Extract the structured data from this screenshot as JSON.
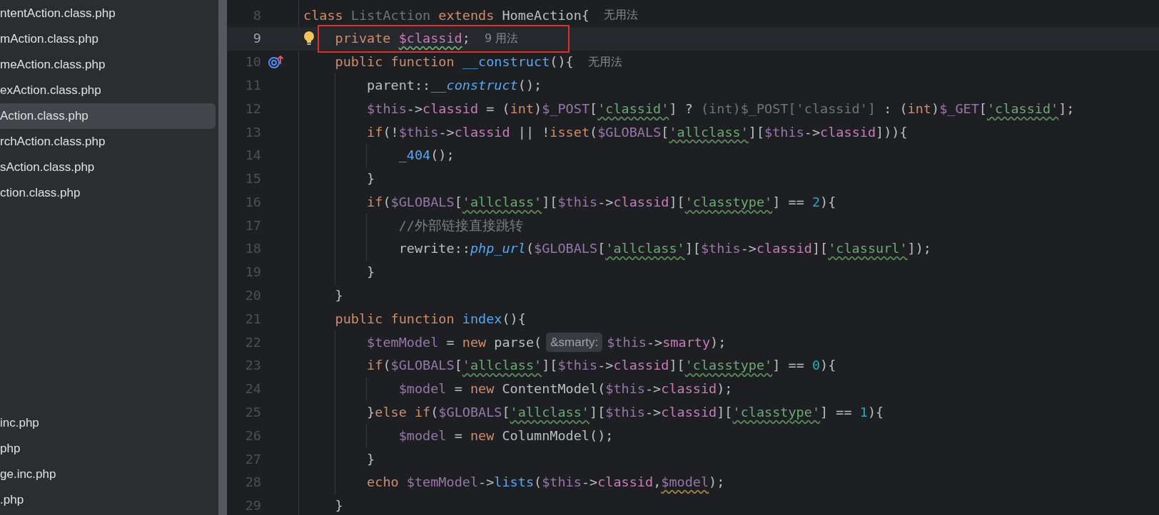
{
  "sidebar": {
    "groups": [
      [
        {
          "label": "ntentAction.class.php",
          "selected": false
        },
        {
          "label": "mAction.class.php",
          "selected": false
        },
        {
          "label": "meAction.class.php",
          "selected": false
        },
        {
          "label": "exAction.class.php",
          "selected": false
        },
        {
          "label": "Action.class.php",
          "selected": true
        },
        {
          "label": "rchAction.class.php",
          "selected": false
        },
        {
          "label": "sAction.class.php",
          "selected": false
        },
        {
          "label": "ction.class.php",
          "selected": false
        }
      ],
      [
        {
          "label": "inc.php",
          "selected": false
        },
        {
          "label": "php",
          "selected": false
        },
        {
          "label": "ge.inc.php",
          "selected": false
        },
        {
          "label": ".php",
          "selected": false
        }
      ]
    ]
  },
  "editor": {
    "lines": [
      {
        "number": "8",
        "current": false,
        "segments": [
          {
            "kind": "code",
            "tokens": [
              {
                "text": "class ",
                "kind": "kw"
              },
              {
                "text": "ListAction",
                "kind": "dim"
              },
              {
                "text": " extends ",
                "kind": "kw"
              },
              {
                "text": "HomeAction{",
                "kind": "p"
              }
            ]
          },
          {
            "kind": "usage_hint",
            "text": "无用法"
          }
        ],
        "children": [
          {
            "number": "9",
            "current": true,
            "framed": true,
            "bulb": true,
            "segments": [
              {
                "kind": "code",
                "tokens": [
                  {
                    "text": "private ",
                    "kind": "kw"
                  },
                  {
                    "text": "$classid",
                    "kind": "field_typo"
                  },
                  {
                    "text": ";",
                    "kind": "p"
                  }
                ]
              },
              {
                "kind": "usage_hint",
                "text": "9 用法"
              }
            ]
          },
          {
            "number": "10",
            "current": false,
            "override_mark": true,
            "segments": [
              {
                "kind": "code",
                "tokens": [
                  {
                    "text": "public function ",
                    "kind": "kw"
                  },
                  {
                    "text": "__construct",
                    "kind": "fn"
                  },
                  {
                    "text": "(){",
                    "kind": "p"
                  }
                ]
              },
              {
                "kind": "usage_hint",
                "text": "无用法"
              }
            ],
            "children": [
              {
                "number": "11",
                "current": false,
                "segments": [
                  {
                    "kind": "code",
                    "tokens": [
                      {
                        "text": "parent::",
                        "kind": "p"
                      },
                      {
                        "text": "__construct",
                        "kind": "fni"
                      },
                      {
                        "text": "();",
                        "kind": "p"
                      }
                    ]
                  }
                ]
              },
              {
                "number": "12",
                "current": false,
                "segments": [
                  {
                    "kind": "code",
                    "tokens": [
                      {
                        "text": "$this",
                        "kind": "var"
                      },
                      {
                        "text": "->",
                        "kind": "p"
                      },
                      {
                        "text": "classid",
                        "kind": "field"
                      },
                      {
                        "text": " = (",
                        "kind": "p"
                      },
                      {
                        "text": "int",
                        "kind": "kw"
                      },
                      {
                        "text": ")",
                        "kind": "p"
                      },
                      {
                        "text": "$_POST",
                        "kind": "var"
                      },
                      {
                        "text": "[",
                        "kind": "p"
                      },
                      {
                        "text": "'classid'",
                        "kind": "str_typo"
                      },
                      {
                        "text": "] ? ",
                        "kind": "p"
                      },
                      {
                        "text": "(int)$_POST['classid']",
                        "kind": "dim"
                      },
                      {
                        "text": " : (",
                        "kind": "p"
                      },
                      {
                        "text": "int",
                        "kind": "kw"
                      },
                      {
                        "text": ")",
                        "kind": "p"
                      },
                      {
                        "text": "$_GET",
                        "kind": "var"
                      },
                      {
                        "text": "[",
                        "kind": "p"
                      },
                      {
                        "text": "'classid'",
                        "kind": "str_typo"
                      },
                      {
                        "text": "];",
                        "kind": "p"
                      }
                    ]
                  }
                ]
              },
              {
                "number": "13",
                "current": false,
                "segments": [
                  {
                    "kind": "code",
                    "tokens": [
                      {
                        "text": "if",
                        "kind": "kw"
                      },
                      {
                        "text": "(!",
                        "kind": "p"
                      },
                      {
                        "text": "$this",
                        "kind": "var"
                      },
                      {
                        "text": "->",
                        "kind": "p"
                      },
                      {
                        "text": "classid",
                        "kind": "field"
                      },
                      {
                        "text": " || !",
                        "kind": "p"
                      },
                      {
                        "text": "isset",
                        "kind": "kw"
                      },
                      {
                        "text": "(",
                        "kind": "p"
                      },
                      {
                        "text": "$GLOBALS",
                        "kind": "var"
                      },
                      {
                        "text": "[",
                        "kind": "p"
                      },
                      {
                        "text": "'allclass'",
                        "kind": "str_typo"
                      },
                      {
                        "text": "][",
                        "kind": "p"
                      },
                      {
                        "text": "$this",
                        "kind": "var"
                      },
                      {
                        "text": "->",
                        "kind": "p"
                      },
                      {
                        "text": "classid",
                        "kind": "field"
                      },
                      {
                        "text": "])){",
                        "kind": "p"
                      }
                    ]
                  }
                ],
                "children": [
                  {
                    "number": "14",
                    "current": false,
                    "segments": [
                      {
                        "kind": "code",
                        "tokens": [
                          {
                            "text": "_404",
                            "kind": "fn"
                          },
                          {
                            "text": "();",
                            "kind": "p"
                          }
                        ]
                      }
                    ]
                  }
                ]
              },
              {
                "number": "15",
                "current": false,
                "segments": [
                  {
                    "kind": "code",
                    "tokens": [
                      {
                        "text": "}",
                        "kind": "p"
                      }
                    ]
                  }
                ]
              },
              {
                "number": "16",
                "current": false,
                "segments": [
                  {
                    "kind": "code",
                    "tokens": [
                      {
                        "text": "if",
                        "kind": "kw"
                      },
                      {
                        "text": "(",
                        "kind": "p"
                      },
                      {
                        "text": "$GLOBALS",
                        "kind": "var"
                      },
                      {
                        "text": "[",
                        "kind": "p"
                      },
                      {
                        "text": "'allclass'",
                        "kind": "str_typo"
                      },
                      {
                        "text": "][",
                        "kind": "p"
                      },
                      {
                        "text": "$this",
                        "kind": "var"
                      },
                      {
                        "text": "->",
                        "kind": "p"
                      },
                      {
                        "text": "classid",
                        "kind": "field"
                      },
                      {
                        "text": "][",
                        "kind": "p"
                      },
                      {
                        "text": "'classtype'",
                        "kind": "str_typo"
                      },
                      {
                        "text": "] == ",
                        "kind": "p"
                      },
                      {
                        "text": "2",
                        "kind": "num"
                      },
                      {
                        "text": "){",
                        "kind": "p"
                      }
                    ]
                  }
                ],
                "children": [
                  {
                    "number": "17",
                    "current": false,
                    "segments": [
                      {
                        "kind": "code",
                        "tokens": [
                          {
                            "text": "//外部链接直接跳转",
                            "kind": "cm"
                          }
                        ]
                      }
                    ]
                  },
                  {
                    "number": "18",
                    "current": false,
                    "segments": [
                      {
                        "kind": "code",
                        "tokens": [
                          {
                            "text": "rewrite::",
                            "kind": "p"
                          },
                          {
                            "text": "php_url",
                            "kind": "fni"
                          },
                          {
                            "text": "(",
                            "kind": "p"
                          },
                          {
                            "text": "$GLOBALS",
                            "kind": "var"
                          },
                          {
                            "text": "[",
                            "kind": "p"
                          },
                          {
                            "text": "'allclass'",
                            "kind": "str_typo"
                          },
                          {
                            "text": "][",
                            "kind": "p"
                          },
                          {
                            "text": "$this",
                            "kind": "var"
                          },
                          {
                            "text": "->",
                            "kind": "p"
                          },
                          {
                            "text": "classid",
                            "kind": "field"
                          },
                          {
                            "text": "][",
                            "kind": "p"
                          },
                          {
                            "text": "'classurl'",
                            "kind": "str_typo"
                          },
                          {
                            "text": "]);",
                            "kind": "p"
                          }
                        ]
                      }
                    ]
                  }
                ]
              },
              {
                "number": "19",
                "current": false,
                "segments": [
                  {
                    "kind": "code",
                    "tokens": [
                      {
                        "text": "}",
                        "kind": "p"
                      }
                    ]
                  }
                ]
              }
            ]
          },
          {
            "number": "20",
            "current": false,
            "segments": [
              {
                "kind": "code",
                "tokens": [
                  {
                    "text": "}",
                    "kind": "p"
                  }
                ]
              }
            ]
          },
          {
            "number": "21",
            "current": false,
            "segments": [
              {
                "kind": "code",
                "tokens": [
                  {
                    "text": "public function ",
                    "kind": "kw"
                  },
                  {
                    "text": "index",
                    "kind": "fn"
                  },
                  {
                    "text": "(){",
                    "kind": "p"
                  }
                ]
              }
            ],
            "children": [
              {
                "number": "22",
                "current": false,
                "segments": [
                  {
                    "kind": "code",
                    "tokens": [
                      {
                        "text": "$temModel",
                        "kind": "var"
                      },
                      {
                        "text": " = ",
                        "kind": "p"
                      },
                      {
                        "text": "new ",
                        "kind": "kw"
                      },
                      {
                        "text": "parse(",
                        "kind": "p"
                      }
                    ]
                  },
                  {
                    "kind": "param_hint",
                    "text": "&smarty:"
                  },
                  {
                    "kind": "code",
                    "tokens": [
                      {
                        "text": "$this",
                        "kind": "var"
                      },
                      {
                        "text": "->",
                        "kind": "p"
                      },
                      {
                        "text": "smarty",
                        "kind": "field"
                      },
                      {
                        "text": ");",
                        "kind": "p"
                      }
                    ]
                  }
                ]
              },
              {
                "number": "23",
                "current": false,
                "segments": [
                  {
                    "kind": "code",
                    "tokens": [
                      {
                        "text": "if",
                        "kind": "kw"
                      },
                      {
                        "text": "(",
                        "kind": "p"
                      },
                      {
                        "text": "$GLOBALS",
                        "kind": "var"
                      },
                      {
                        "text": "[",
                        "kind": "p"
                      },
                      {
                        "text": "'allclass'",
                        "kind": "str_typo"
                      },
                      {
                        "text": "][",
                        "kind": "p"
                      },
                      {
                        "text": "$this",
                        "kind": "var"
                      },
                      {
                        "text": "->",
                        "kind": "p"
                      },
                      {
                        "text": "classid",
                        "kind": "field"
                      },
                      {
                        "text": "][",
                        "kind": "p"
                      },
                      {
                        "text": "'classtype'",
                        "kind": "str_typo"
                      },
                      {
                        "text": "] == ",
                        "kind": "p"
                      },
                      {
                        "text": "0",
                        "kind": "num"
                      },
                      {
                        "text": "){",
                        "kind": "p"
                      }
                    ]
                  }
                ],
                "children": [
                  {
                    "number": "24",
                    "current": false,
                    "segments": [
                      {
                        "kind": "code",
                        "tokens": [
                          {
                            "text": "$model",
                            "kind": "var"
                          },
                          {
                            "text": " = ",
                            "kind": "p"
                          },
                          {
                            "text": "new ",
                            "kind": "kw"
                          },
                          {
                            "text": "ContentModel(",
                            "kind": "p"
                          },
                          {
                            "text": "$this",
                            "kind": "var"
                          },
                          {
                            "text": "->",
                            "kind": "p"
                          },
                          {
                            "text": "classid",
                            "kind": "field"
                          },
                          {
                            "text": ");",
                            "kind": "p"
                          }
                        ]
                      }
                    ]
                  }
                ]
              },
              {
                "number": "25",
                "current": false,
                "segments": [
                  {
                    "kind": "code",
                    "tokens": [
                      {
                        "text": "}",
                        "kind": "p"
                      },
                      {
                        "text": "else if",
                        "kind": "kw"
                      },
                      {
                        "text": "(",
                        "kind": "p"
                      },
                      {
                        "text": "$GLOBALS",
                        "kind": "var"
                      },
                      {
                        "text": "[",
                        "kind": "p"
                      },
                      {
                        "text": "'allclass'",
                        "kind": "str_typo"
                      },
                      {
                        "text": "][",
                        "kind": "p"
                      },
                      {
                        "text": "$this",
                        "kind": "var"
                      },
                      {
                        "text": "->",
                        "kind": "p"
                      },
                      {
                        "text": "classid",
                        "kind": "field"
                      },
                      {
                        "text": "][",
                        "kind": "p"
                      },
                      {
                        "text": "'classtype'",
                        "kind": "str_typo"
                      },
                      {
                        "text": "] == ",
                        "kind": "p"
                      },
                      {
                        "text": "1",
                        "kind": "num"
                      },
                      {
                        "text": "){",
                        "kind": "p"
                      }
                    ]
                  }
                ],
                "children": [
                  {
                    "number": "26",
                    "current": false,
                    "segments": [
                      {
                        "kind": "code",
                        "tokens": [
                          {
                            "text": "$model",
                            "kind": "var"
                          },
                          {
                            "text": " = ",
                            "kind": "p"
                          },
                          {
                            "text": "new ",
                            "kind": "kw"
                          },
                          {
                            "text": "ColumnModel();",
                            "kind": "p"
                          }
                        ]
                      }
                    ]
                  }
                ]
              },
              {
                "number": "27",
                "current": false,
                "segments": [
                  {
                    "kind": "code",
                    "tokens": [
                      {
                        "text": "}",
                        "kind": "p"
                      }
                    ]
                  }
                ]
              },
              {
                "number": "28",
                "current": false,
                "segments": [
                  {
                    "kind": "code",
                    "tokens": [
                      {
                        "text": "echo ",
                        "kind": "kw"
                      },
                      {
                        "text": "$temModel",
                        "kind": "var"
                      },
                      {
                        "text": "->",
                        "kind": "p"
                      },
                      {
                        "text": "lists",
                        "kind": "fn"
                      },
                      {
                        "text": "(",
                        "kind": "p"
                      },
                      {
                        "text": "$this",
                        "kind": "var"
                      },
                      {
                        "text": "->",
                        "kind": "p"
                      },
                      {
                        "text": "classid",
                        "kind": "field"
                      },
                      {
                        "text": ",",
                        "kind": "p"
                      },
                      {
                        "text": "$model",
                        "kind": "var_warn"
                      },
                      {
                        "text": ");",
                        "kind": "p"
                      }
                    ]
                  }
                ]
              }
            ]
          },
          {
            "number": "29",
            "current": false,
            "segments": [
              {
                "kind": "code",
                "tokens": [
                  {
                    "text": "}",
                    "kind": "p"
                  }
                ]
              }
            ]
          }
        ]
      }
    ]
  }
}
